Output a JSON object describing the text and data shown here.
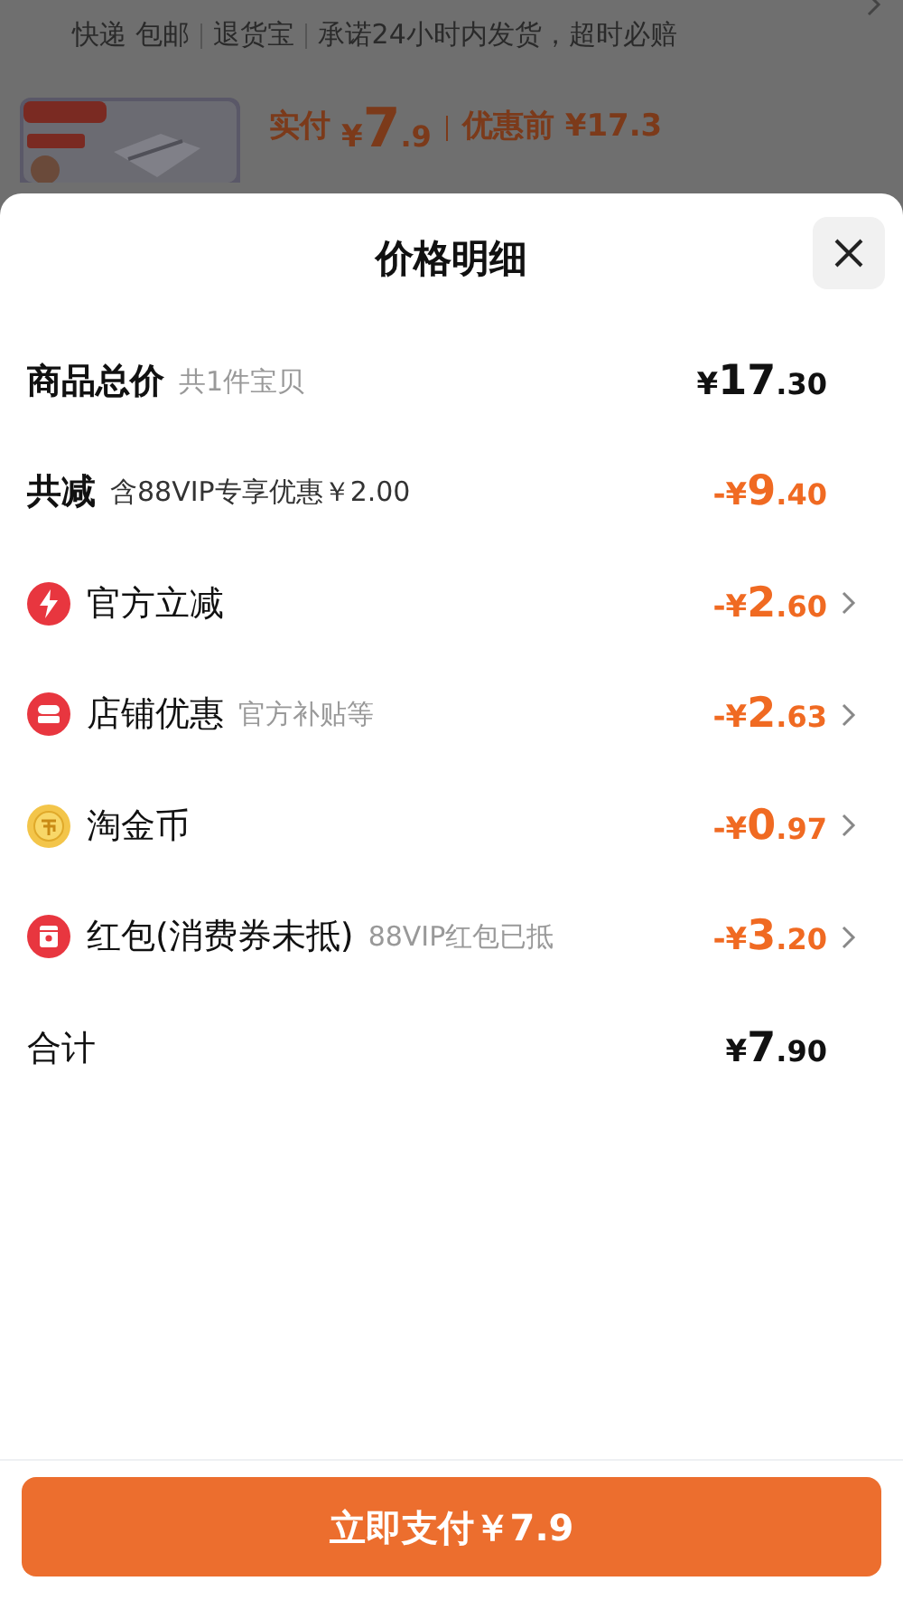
{
  "background": {
    "services": [
      "快递 包邮",
      "退货宝",
      "承诺24小时内发货，超时必赔"
    ],
    "summary": {
      "paid_label": "实付",
      "paid_price": "¥7.9",
      "before_label": "优惠前",
      "before_price": "¥17.3"
    }
  },
  "sheet": {
    "title": "价格明细",
    "rows": [
      {
        "kind": "heading",
        "label": "商品总价",
        "note": "共1件宝贝",
        "amount": "¥17.30",
        "discount": false,
        "arrow": false
      },
      {
        "kind": "heading",
        "label": "共减",
        "note": "含88VIP专享优惠￥2.00",
        "amount": "-¥9.40",
        "discount": true,
        "arrow": false
      },
      {
        "kind": "bolt",
        "label": "官方立减",
        "amount": "-¥2.60",
        "discount": true,
        "arrow": true
      },
      {
        "kind": "shop",
        "label": "店铺优惠",
        "note": "官方补贴等",
        "amount": "-¥2.63",
        "discount": true,
        "arrow": true
      },
      {
        "kind": "coin",
        "label": "淘金币",
        "amount": "-¥0.97",
        "discount": true,
        "arrow": true
      },
      {
        "kind": "packet",
        "label": "红包(消费券未抵)",
        "note": "88VIP红包已抵",
        "amount": "-¥3.20",
        "discount": true,
        "arrow": true
      },
      {
        "kind": "plain",
        "label": "合计",
        "amount": "¥7.90",
        "discount": false,
        "arrow": false
      }
    ],
    "pay_button": "立即支付￥7.9"
  }
}
